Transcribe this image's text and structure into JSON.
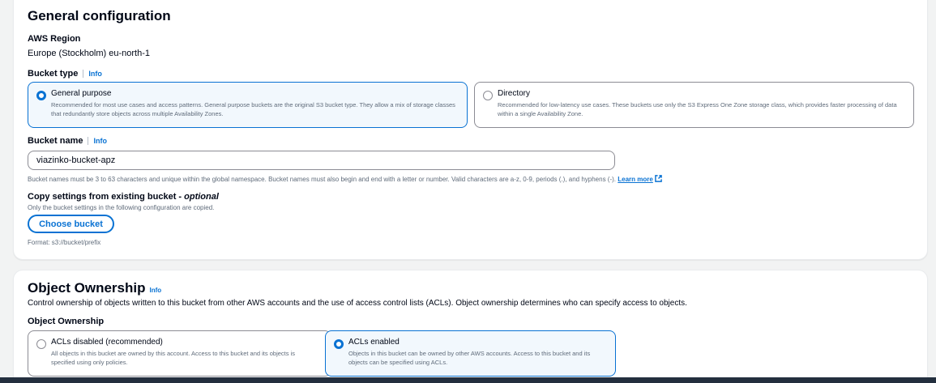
{
  "general": {
    "title": "General configuration",
    "region_label": "AWS Region",
    "region_value": "Europe (Stockholm) eu-north-1",
    "bucket_type_label": "Bucket type",
    "info": "Info",
    "types": [
      {
        "title": "General purpose",
        "desc": "Recommended for most use cases and access patterns. General purpose buckets are the original S3 bucket type. They allow a mix of storage classes that redundantly store objects across multiple Availability Zones.",
        "selected": true
      },
      {
        "title": "Directory",
        "desc": "Recommended for low-latency use cases. These buckets use only the S3 Express One Zone storage class, which provides faster processing of data within a single Availability Zone.",
        "selected": false
      }
    ],
    "bucket_name_label": "Bucket name",
    "bucket_name_value": "viazinko-bucket-apz",
    "bucket_name_hint": "Bucket names must be 3 to 63 characters and unique within the global namespace. Bucket names must also begin and end with a letter or number. Valid characters are a-z, 0-9, periods (.), and hyphens (-).",
    "learn_more": "Learn more",
    "copy_label": "Copy settings from existing bucket - ",
    "copy_optional": "optional",
    "copy_desc": "Only the bucket settings in the following configuration are copied.",
    "choose_bucket": "Choose bucket",
    "format_hint": "Format: s3://bucket/prefix"
  },
  "ownership": {
    "title": "Object Ownership",
    "info": "Info",
    "desc": "Control ownership of objects written to this bucket from other AWS accounts and the use of access control lists (ACLs). Object ownership determines who can specify access to objects.",
    "label": "Object Ownership",
    "options": [
      {
        "title": "ACLs disabled (recommended)",
        "desc": "All objects in this bucket are owned by this account. Access to this bucket and its objects is specified using only policies.",
        "selected": false
      },
      {
        "title": "ACLs enabled",
        "desc": "Objects in this bucket can be owned by other AWS accounts. Access to this bucket and its objects can be specified using ACLs.",
        "selected": true
      }
    ]
  },
  "icons": {
    "external_link": "external-link-icon"
  },
  "colors": {
    "accent": "#0972d3",
    "selected_bg": "#f2f8fd",
    "taskbar": "#232f3e"
  }
}
